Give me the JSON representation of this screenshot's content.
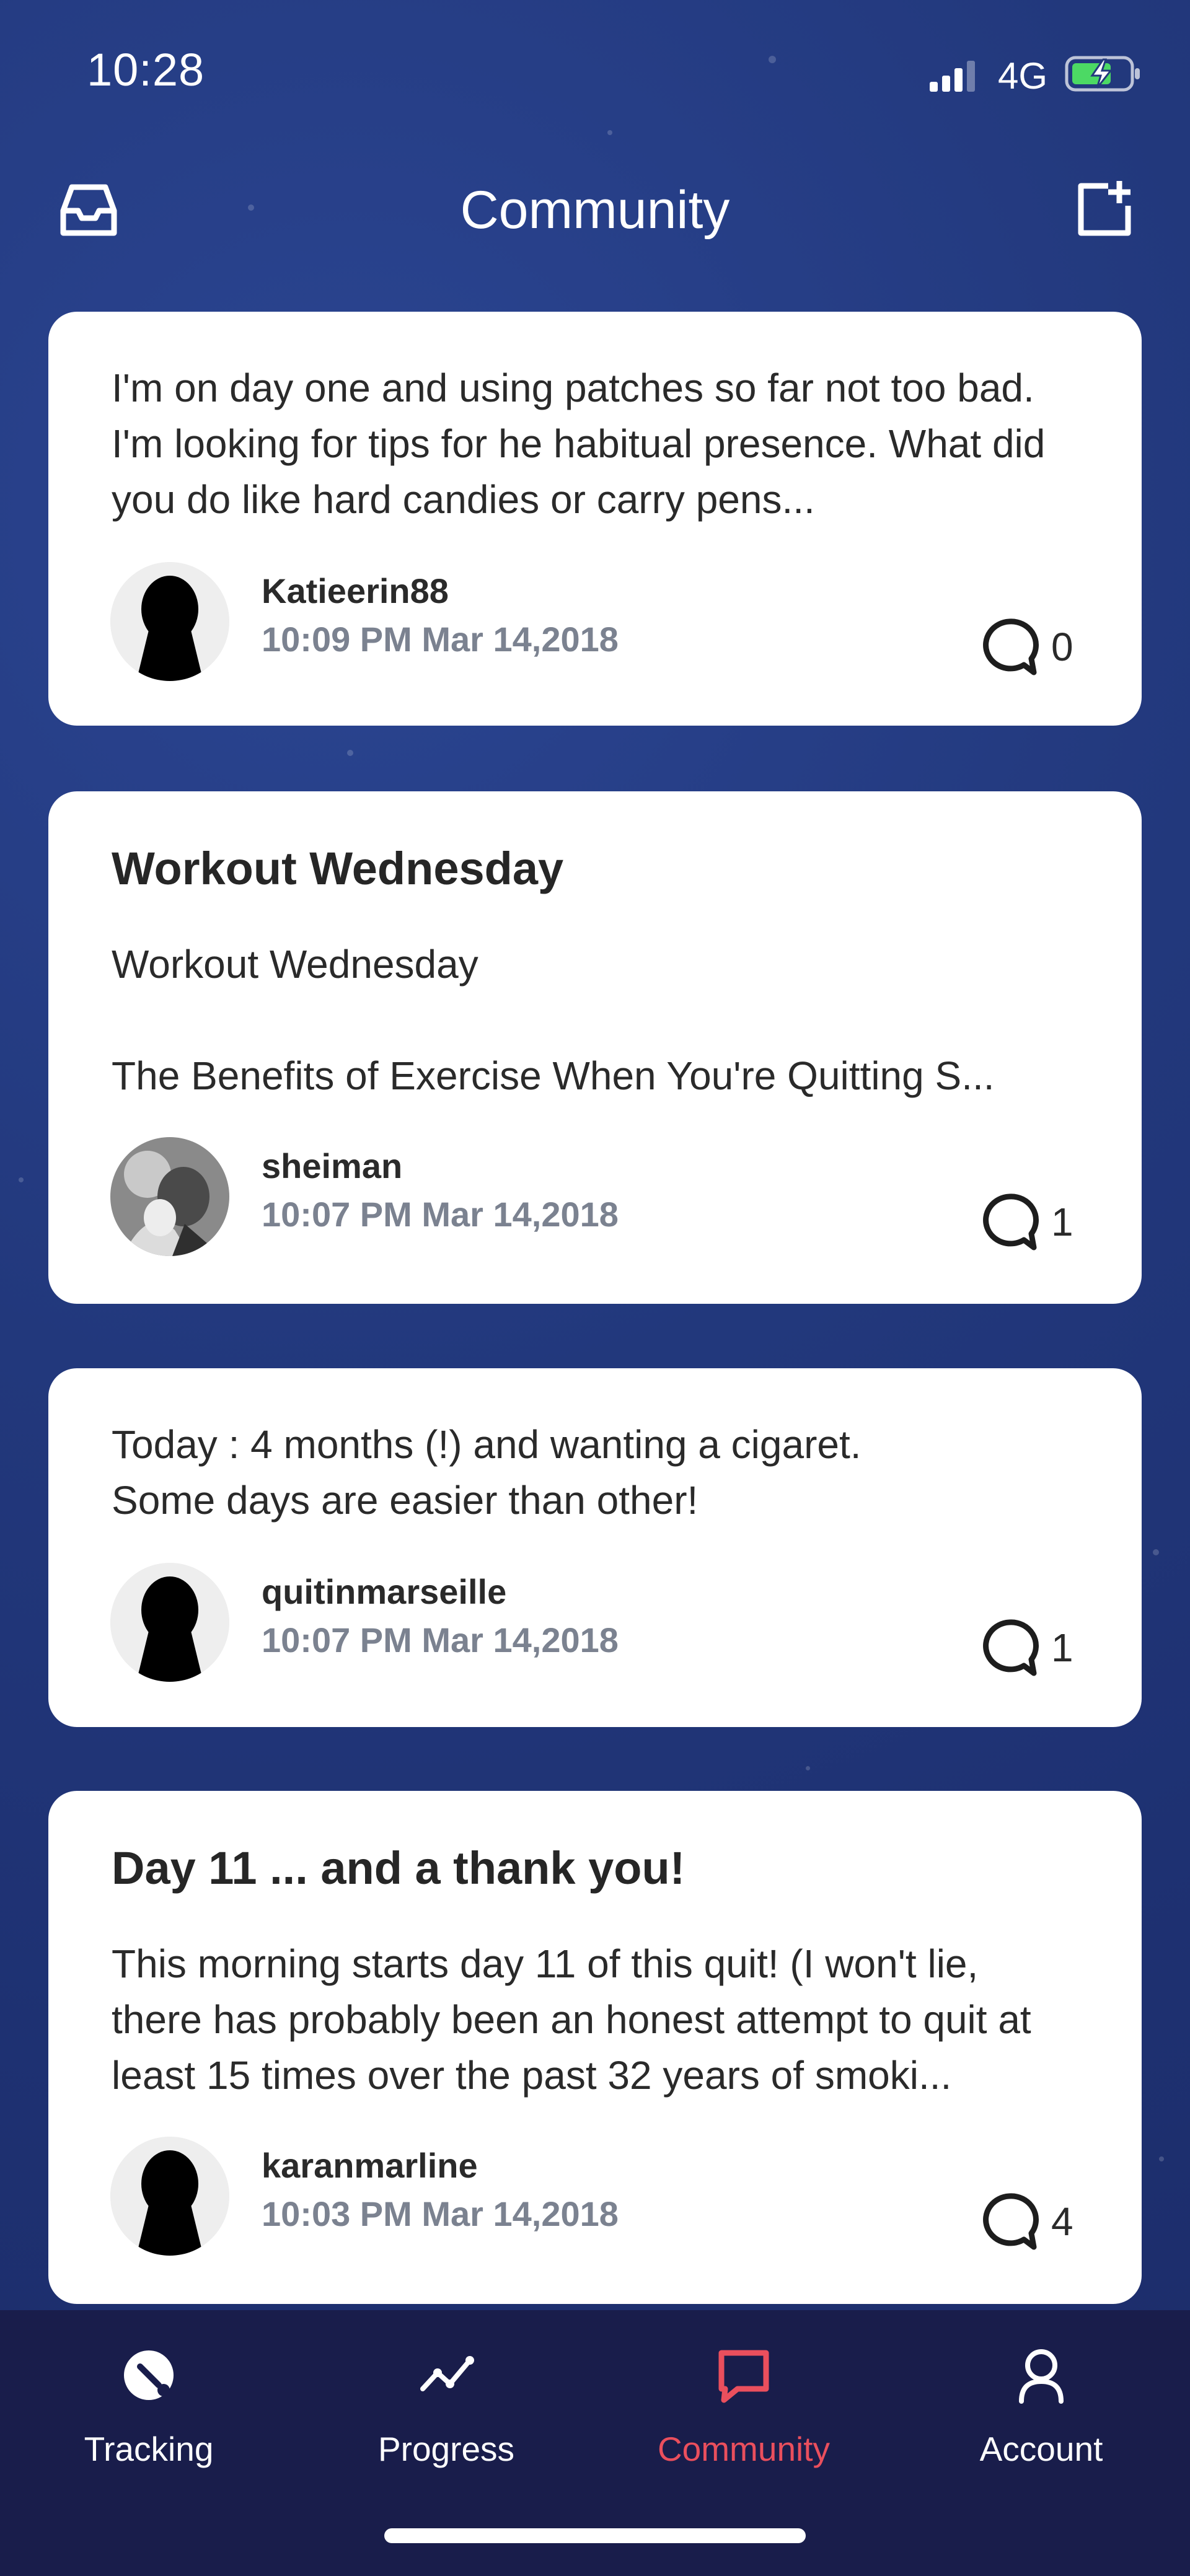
{
  "status_bar": {
    "time": "10:28",
    "network": "4G",
    "icons": [
      "signal-icon",
      "battery-charging-icon"
    ]
  },
  "header": {
    "title": "Community",
    "left_icon": "inbox-icon",
    "right_icon": "new-post-icon"
  },
  "posts": [
    {
      "title": "",
      "body": "I'm on day one and using patches so far not too bad. I'm looking for tips for he habitual presence. What did you do like hard candies or carry pens...",
      "author": "Katieerin88",
      "timestamp": "10:09 PM Mar 14,2018",
      "comments": "0",
      "avatar": "silhouette"
    },
    {
      "title": "Workout Wednesday",
      "body": "Workout Wednesday\n\nThe Benefits of Exercise When You're Quitting S...",
      "author": "sheiman",
      "timestamp": "10:07 PM Mar 14,2018",
      "comments": "1",
      "avatar": "photo"
    },
    {
      "title": "",
      "body": "Today : 4 months (!) and wanting a cigaret.\nSome days are easier than other!",
      "author": "quitinmarseille",
      "timestamp": "10:07 PM Mar 14,2018",
      "comments": "1",
      "avatar": "silhouette"
    },
    {
      "title": "Day 11 ... and a thank you!",
      "body": "This morning starts day 11 of this quit! (I won't lie, there has probably been an honest attempt to quit at least 15 times over the past 32 years of smoki...",
      "author": "karanmarline",
      "timestamp": "10:03 PM Mar 14,2018",
      "comments": "4",
      "avatar": "silhouette"
    }
  ],
  "tab_bar": {
    "tabs": [
      {
        "label": "Tracking",
        "icon": "tracking-icon"
      },
      {
        "label": "Progress",
        "icon": "progress-icon"
      },
      {
        "label": "Community",
        "icon": "community-icon",
        "active": true
      },
      {
        "label": "Account",
        "icon": "account-icon"
      }
    ]
  },
  "colors": {
    "background": "#22387c",
    "card": "#ffffff",
    "tab_bar": "#191d4b",
    "accent": "#ea4f5d",
    "timestamp": "#7b8290"
  }
}
